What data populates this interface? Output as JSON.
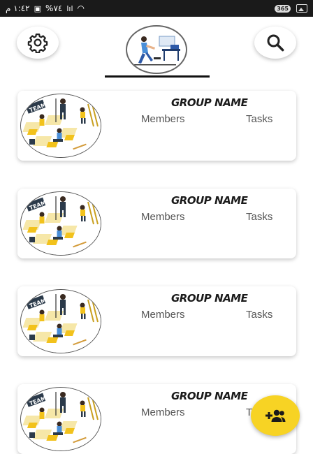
{
  "status_bar": {
    "time": "١:٤٢ م",
    "battery": "%٧٤",
    "badge": "365"
  },
  "header": {
    "settings_icon": "gear-icon",
    "search_icon": "search-icon",
    "avatar": "profile-illustration"
  },
  "groups": [
    {
      "name": "GROUP NAME",
      "members_label": "Members",
      "tasks_label": "Tasks"
    },
    {
      "name": "GROUP NAME",
      "members_label": "Members",
      "tasks_label": "Tasks"
    },
    {
      "name": "GROUP NAME",
      "members_label": "Members",
      "tasks_label": "Tasks"
    },
    {
      "name": "GROUP NAME",
      "members_label": "Members",
      "tasks_label": "Tasks"
    }
  ],
  "fab": {
    "icon": "add-group-icon"
  },
  "colors": {
    "accent": "#f7d324",
    "card_bg": "#ffffff",
    "status_bar": "#1a1a1a"
  }
}
